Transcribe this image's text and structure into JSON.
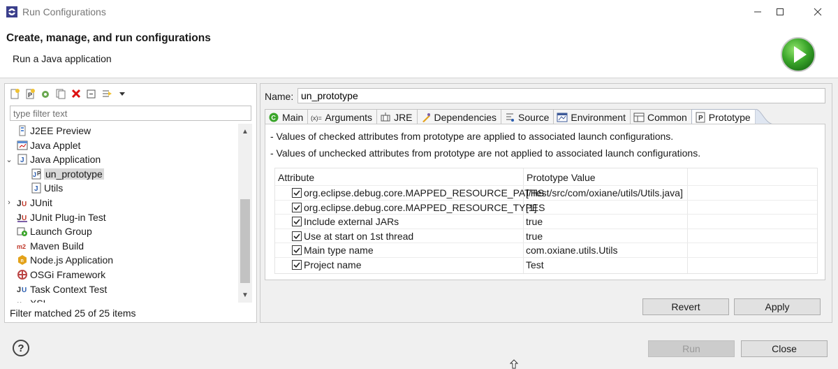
{
  "window": {
    "title": "Run Configurations"
  },
  "header": {
    "title": "Create, manage, and run configurations",
    "subtitle": "Run a Java application",
    "run_icon": "run-play-icon"
  },
  "left": {
    "filter_placeholder": "type filter text",
    "tree": [
      {
        "label": "J2EE Preview",
        "icon": "j2ee-preview-icon",
        "level": 1,
        "twisty": ""
      },
      {
        "label": "Java Applet",
        "icon": "java-applet-icon",
        "level": 1,
        "twisty": ""
      },
      {
        "label": "Java Application",
        "icon": "java-application-icon",
        "level": 1,
        "twisty": "expanded"
      },
      {
        "label": "un_prototype",
        "icon": "prototype-icon",
        "level": 2,
        "twisty": "",
        "selected": true
      },
      {
        "label": "Utils",
        "icon": "java-config-icon",
        "level": 2,
        "twisty": ""
      },
      {
        "label": "JUnit",
        "icon": "junit-icon",
        "level": 1,
        "twisty": "collapsed"
      },
      {
        "label": "JUnit Plug-in Test",
        "icon": "junit-plugin-icon",
        "level": 1,
        "twisty": ""
      },
      {
        "label": "Launch Group",
        "icon": "launch-group-icon",
        "level": 1,
        "twisty": ""
      },
      {
        "label": "Maven Build",
        "icon": "maven-icon",
        "level": 1,
        "twisty": ""
      },
      {
        "label": "Node.js Application",
        "icon": "nodejs-icon",
        "level": 1,
        "twisty": ""
      },
      {
        "label": "OSGi Framework",
        "icon": "osgi-icon",
        "level": 1,
        "twisty": ""
      },
      {
        "label": "Task Context Test",
        "icon": "task-context-icon",
        "level": 1,
        "twisty": ""
      },
      {
        "label": "XSL",
        "icon": "xsl-icon",
        "level": 1,
        "twisty": ""
      }
    ],
    "status": "Filter matched 25 of 25 items"
  },
  "right": {
    "name_label": "Name:",
    "name_value": "un_prototype",
    "tabs": [
      {
        "label": "Main",
        "icon": "main-tab-icon"
      },
      {
        "label": "Arguments",
        "icon": "arguments-tab-icon"
      },
      {
        "label": "JRE",
        "icon": "jre-tab-icon"
      },
      {
        "label": "Dependencies",
        "icon": "dependencies-tab-icon"
      },
      {
        "label": "Source",
        "icon": "source-tab-icon"
      },
      {
        "label": "Environment",
        "icon": "environment-tab-icon"
      },
      {
        "label": "Common",
        "icon": "common-tab-icon"
      },
      {
        "label": "Prototype",
        "icon": "prototype-tab-icon",
        "active": true
      }
    ],
    "desc1": "- Values of checked attributes from prototype are applied to associated launch configurations.",
    "desc2": "- Values of unchecked attributes from prototype are not applied to associated launch configurations.",
    "table": {
      "col_attr": "Attribute",
      "col_val": "Prototype Value",
      "rows": [
        {
          "attr": "org.eclipse.debug.core.MAPPED_RESOURCE_PATHS",
          "value": "[/Test/src/com/oxiane/utils/Utils.java]",
          "checked": true
        },
        {
          "attr": "org.eclipse.debug.core.MAPPED_RESOURCE_TYPES",
          "value": "[1]",
          "checked": true
        },
        {
          "attr": "Include external JARs",
          "value": "true",
          "checked": true
        },
        {
          "attr": "Use at start on 1st thread",
          "value": "true",
          "checked": true
        },
        {
          "attr": "Main type name",
          "value": "com.oxiane.utils.Utils",
          "checked": true
        },
        {
          "attr": "Project name",
          "value": "Test",
          "checked": true
        }
      ]
    },
    "revert_label": "Revert",
    "apply_label": "Apply"
  },
  "footer": {
    "run_label": "Run",
    "close_label": "Close",
    "help_label": "?"
  }
}
